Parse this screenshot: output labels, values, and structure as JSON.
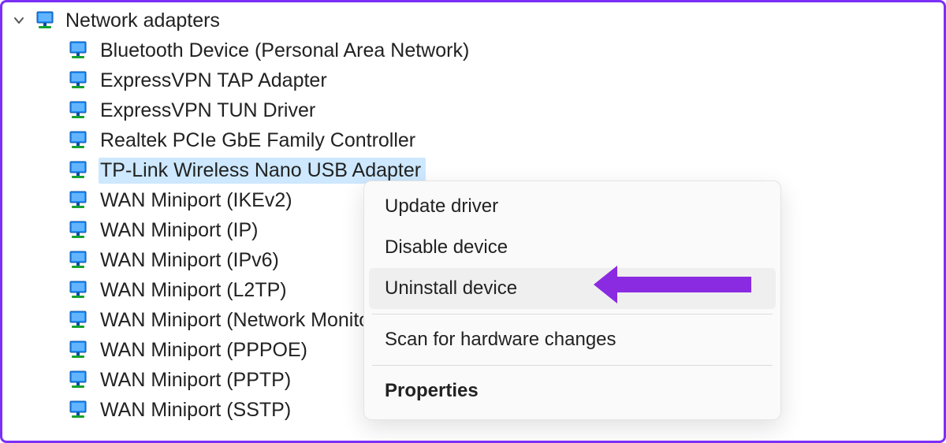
{
  "colors": {
    "highlight": "#cde8ff",
    "border": "#7b2ff7",
    "arrow": "#8a2be2",
    "menu_hover": "#efefef"
  },
  "category": {
    "label": "Network adapters",
    "expanded": true
  },
  "devices": [
    {
      "label": "Bluetooth Device (Personal Area Network)",
      "selected": false
    },
    {
      "label": "ExpressVPN TAP Adapter",
      "selected": false
    },
    {
      "label": "ExpressVPN TUN Driver",
      "selected": false
    },
    {
      "label": "Realtek PCIe GbE Family Controller",
      "selected": false
    },
    {
      "label": "TP-Link Wireless Nano USB Adapter",
      "selected": true
    },
    {
      "label": "WAN Miniport (IKEv2)",
      "selected": false
    },
    {
      "label": "WAN Miniport (IP)",
      "selected": false
    },
    {
      "label": "WAN Miniport (IPv6)",
      "selected": false
    },
    {
      "label": "WAN Miniport (L2TP)",
      "selected": false
    },
    {
      "label": "WAN Miniport (Network Monitor)",
      "selected": false
    },
    {
      "label": "WAN Miniport (PPPOE)",
      "selected": false
    },
    {
      "label": "WAN Miniport (PPTP)",
      "selected": false
    },
    {
      "label": "WAN Miniport (SSTP)",
      "selected": false
    }
  ],
  "context_menu": {
    "items": [
      {
        "label": "Update driver",
        "highlighted": false,
        "bold": false
      },
      {
        "label": "Disable device",
        "highlighted": false,
        "bold": false
      },
      {
        "label": "Uninstall device",
        "highlighted": true,
        "bold": false
      },
      {
        "separator": true
      },
      {
        "label": "Scan for hardware changes",
        "highlighted": false,
        "bold": false
      },
      {
        "separator": true
      },
      {
        "label": "Properties",
        "highlighted": false,
        "bold": true
      }
    ]
  }
}
